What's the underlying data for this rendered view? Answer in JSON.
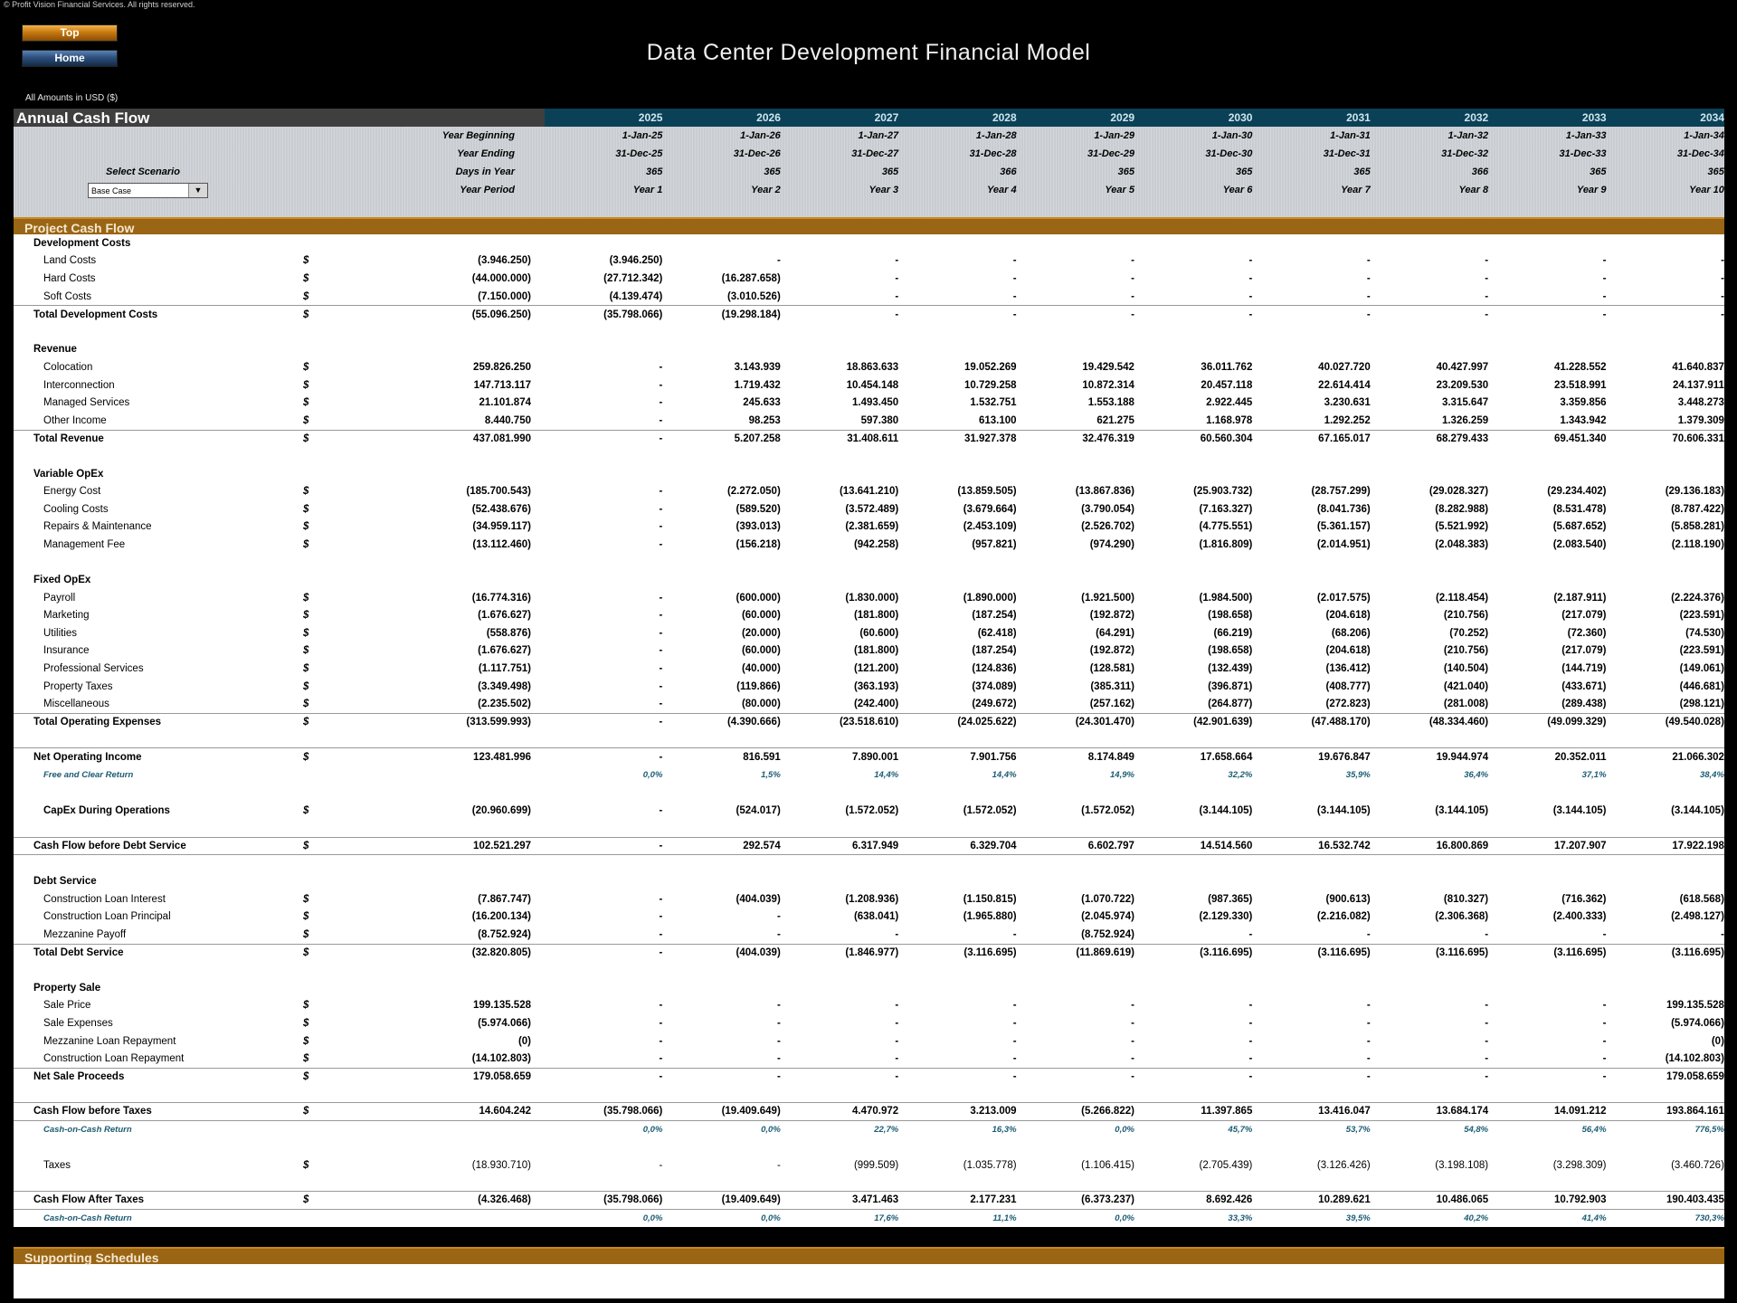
{
  "copyright": "© Profit Vision Financial Services. All rights reserved.",
  "nav": {
    "top_label": "Top",
    "home_label": "Home"
  },
  "title": "Data Center Development Financial Model",
  "amounts_note": "All Amounts in  USD ($)",
  "sheet_title": "Annual Cash Flow",
  "years": [
    "2025",
    "2026",
    "2027",
    "2028",
    "2029",
    "2030",
    "2031",
    "2032",
    "2033",
    "2034"
  ],
  "meta": {
    "labels": {
      "begin": "Year Beginning",
      "end": "Year Ending",
      "days": "Days in Year",
      "period": "Year Period"
    },
    "scenario_label": "Select Scenario",
    "scenario_value": "Base Case",
    "begin": [
      "1-Jan-25",
      "1-Jan-26",
      "1-Jan-27",
      "1-Jan-28",
      "1-Jan-29",
      "1-Jan-30",
      "1-Jan-31",
      "1-Jan-32",
      "1-Jan-33",
      "1-Jan-34"
    ],
    "end": [
      "31-Dec-25",
      "31-Dec-26",
      "31-Dec-27",
      "31-Dec-28",
      "31-Dec-29",
      "31-Dec-30",
      "31-Dec-31",
      "31-Dec-32",
      "31-Dec-33",
      "31-Dec-34"
    ],
    "days": [
      "365",
      "365",
      "365",
      "366",
      "365",
      "365",
      "365",
      "366",
      "365",
      "365"
    ],
    "period": [
      "Year 1",
      "Year 2",
      "Year 3",
      "Year 4",
      "Year 5",
      "Year 6",
      "Year 7",
      "Year 8",
      "Year 9",
      "Year 10"
    ]
  },
  "section_project": "Project Cash Flow",
  "section_support": "Supporting Schedules",
  "currency": "$",
  "rows": [
    {
      "type": "header",
      "label": "Development Costs"
    },
    {
      "type": "sub",
      "label": "Land Costs",
      "total": "(3.946.250)",
      "values": [
        "(3.946.250)",
        "-",
        "-",
        "-",
        "-",
        "-",
        "-",
        "-",
        "-",
        "-"
      ]
    },
    {
      "type": "sub",
      "label": "Hard Costs",
      "total": "(44.000.000)",
      "values": [
        "(27.712.342)",
        "(16.287.658)",
        "-",
        "-",
        "-",
        "-",
        "-",
        "-",
        "-",
        "-"
      ]
    },
    {
      "type": "sub",
      "label": "Soft Costs",
      "total": "(7.150.000)",
      "values": [
        "(4.139.474)",
        "(3.010.526)",
        "-",
        "-",
        "-",
        "-",
        "-",
        "-",
        "-",
        "-"
      ]
    },
    {
      "type": "total",
      "label": "Total Development Costs",
      "total": "(55.096.250)",
      "values": [
        "(35.798.066)",
        "(19.298.184)",
        "-",
        "-",
        "-",
        "-",
        "-",
        "-",
        "-",
        "-"
      ],
      "lineTop": true
    },
    {
      "type": "spacer"
    },
    {
      "type": "header",
      "label": "Revenue"
    },
    {
      "type": "sub",
      "label": "Colocation",
      "total": "259.826.250",
      "values": [
        "-",
        "3.143.939",
        "18.863.633",
        "19.052.269",
        "19.429.542",
        "36.011.762",
        "40.027.720",
        "40.427.997",
        "41.228.552",
        "41.640.837"
      ]
    },
    {
      "type": "sub",
      "label": "Interconnection",
      "total": "147.713.117",
      "values": [
        "-",
        "1.719.432",
        "10.454.148",
        "10.729.258",
        "10.872.314",
        "20.457.118",
        "22.614.414",
        "23.209.530",
        "23.518.991",
        "24.137.911"
      ]
    },
    {
      "type": "sub",
      "label": "Managed Services",
      "total": "21.101.874",
      "values": [
        "-",
        "245.633",
        "1.493.450",
        "1.532.751",
        "1.553.188",
        "2.922.445",
        "3.230.631",
        "3.315.647",
        "3.359.856",
        "3.448.273"
      ]
    },
    {
      "type": "sub",
      "label": "Other Income",
      "total": "8.440.750",
      "values": [
        "-",
        "98.253",
        "597.380",
        "613.100",
        "621.275",
        "1.168.978",
        "1.292.252",
        "1.326.259",
        "1.343.942",
        "1.379.309"
      ]
    },
    {
      "type": "total",
      "label": "Total Revenue",
      "total": "437.081.990",
      "values": [
        "-",
        "5.207.258",
        "31.408.611",
        "31.927.378",
        "32.476.319",
        "60.560.304",
        "67.165.017",
        "68.279.433",
        "69.451.340",
        "70.606.331"
      ],
      "lineTop": true
    },
    {
      "type": "spacer"
    },
    {
      "type": "header",
      "label": "Variable OpEx"
    },
    {
      "type": "sub",
      "label": "Energy Cost",
      "total": "(185.700.543)",
      "values": [
        "-",
        "(2.272.050)",
        "(13.641.210)",
        "(13.859.505)",
        "(13.867.836)",
        "(25.903.732)",
        "(28.757.299)",
        "(29.028.327)",
        "(29.234.402)",
        "(29.136.183)"
      ]
    },
    {
      "type": "sub",
      "label": "Cooling Costs",
      "total": "(52.438.676)",
      "values": [
        "-",
        "(589.520)",
        "(3.572.489)",
        "(3.679.664)",
        "(3.790.054)",
        "(7.163.327)",
        "(8.041.736)",
        "(8.282.988)",
        "(8.531.478)",
        "(8.787.422)"
      ]
    },
    {
      "type": "sub",
      "label": "Repairs & Maintenance",
      "total": "(34.959.117)",
      "values": [
        "-",
        "(393.013)",
        "(2.381.659)",
        "(2.453.109)",
        "(2.526.702)",
        "(4.775.551)",
        "(5.361.157)",
        "(5.521.992)",
        "(5.687.652)",
        "(5.858.281)"
      ]
    },
    {
      "type": "sub",
      "label": "Management Fee",
      "total": "(13.112.460)",
      "values": [
        "-",
        "(156.218)",
        "(942.258)",
        "(957.821)",
        "(974.290)",
        "(1.816.809)",
        "(2.014.951)",
        "(2.048.383)",
        "(2.083.540)",
        "(2.118.190)"
      ]
    },
    {
      "type": "spacer"
    },
    {
      "type": "header",
      "label": "Fixed OpEx"
    },
    {
      "type": "sub",
      "label": "Payroll",
      "total": "(16.774.316)",
      "values": [
        "-",
        "(600.000)",
        "(1.830.000)",
        "(1.890.000)",
        "(1.921.500)",
        "(1.984.500)",
        "(2.017.575)",
        "(2.118.454)",
        "(2.187.911)",
        "(2.224.376)"
      ]
    },
    {
      "type": "sub",
      "label": "Marketing",
      "total": "(1.676.627)",
      "values": [
        "-",
        "(60.000)",
        "(181.800)",
        "(187.254)",
        "(192.872)",
        "(198.658)",
        "(204.618)",
        "(210.756)",
        "(217.079)",
        "(223.591)"
      ]
    },
    {
      "type": "sub",
      "label": "Utilities",
      "total": "(558.876)",
      "values": [
        "-",
        "(20.000)",
        "(60.600)",
        "(62.418)",
        "(64.291)",
        "(66.219)",
        "(68.206)",
        "(70.252)",
        "(72.360)",
        "(74.530)"
      ]
    },
    {
      "type": "sub",
      "label": "Insurance",
      "total": "(1.676.627)",
      "values": [
        "-",
        "(60.000)",
        "(181.800)",
        "(187.254)",
        "(192.872)",
        "(198.658)",
        "(204.618)",
        "(210.756)",
        "(217.079)",
        "(223.591)"
      ]
    },
    {
      "type": "sub",
      "label": "Professional Services",
      "total": "(1.117.751)",
      "values": [
        "-",
        "(40.000)",
        "(121.200)",
        "(124.836)",
        "(128.581)",
        "(132.439)",
        "(136.412)",
        "(140.504)",
        "(144.719)",
        "(149.061)"
      ]
    },
    {
      "type": "sub",
      "label": "Property Taxes",
      "total": "(3.349.498)",
      "values": [
        "-",
        "(119.866)",
        "(363.193)",
        "(374.089)",
        "(385.311)",
        "(396.871)",
        "(408.777)",
        "(421.040)",
        "(433.671)",
        "(446.681)"
      ]
    },
    {
      "type": "sub",
      "label": "Miscellaneous",
      "total": "(2.235.502)",
      "values": [
        "-",
        "(80.000)",
        "(242.400)",
        "(249.672)",
        "(257.162)",
        "(264.877)",
        "(272.823)",
        "(281.008)",
        "(289.438)",
        "(298.121)"
      ]
    },
    {
      "type": "total",
      "label": "Total Operating Expenses",
      "total": "(313.599.993)",
      "values": [
        "-",
        "(4.390.666)",
        "(23.518.610)",
        "(24.025.622)",
        "(24.301.470)",
        "(42.901.639)",
        "(47.488.170)",
        "(48.334.460)",
        "(49.099.329)",
        "(49.540.028)"
      ],
      "lineTop": true
    },
    {
      "type": "spacer",
      "lineBot": true
    },
    {
      "type": "total",
      "label": "Net Operating Income",
      "total": "123.481.996",
      "values": [
        "-",
        "816.591",
        "7.890.001",
        "7.901.756",
        "8.174.849",
        "17.658.664",
        "19.676.847",
        "19.944.974",
        "20.352.011",
        "21.066.302"
      ]
    },
    {
      "type": "pct",
      "label": "Free and Clear Return",
      "values": [
        "0,0%",
        "1,5%",
        "14,4%",
        "14,4%",
        "14,9%",
        "32,2%",
        "35,9%",
        "36,4%",
        "37,1%",
        "38,4%"
      ]
    },
    {
      "type": "spacer"
    },
    {
      "type": "item",
      "label": "CapEx During Operations",
      "total": "(20.960.699)",
      "values": [
        "-",
        "(524.017)",
        "(1.572.052)",
        "(1.572.052)",
        "(1.572.052)",
        "(3.144.105)",
        "(3.144.105)",
        "(3.144.105)",
        "(3.144.105)",
        "(3.144.105)"
      ]
    },
    {
      "type": "spacer"
    },
    {
      "type": "total",
      "label": "Cash Flow before Debt Service",
      "total": "102.521.297",
      "values": [
        "-",
        "292.574",
        "6.317.949",
        "6.329.704",
        "6.602.797",
        "14.514.560",
        "16.532.742",
        "16.800.869",
        "17.207.907",
        "17.922.198"
      ],
      "lineTop": true,
      "lineBot": true
    },
    {
      "type": "spacer"
    },
    {
      "type": "header",
      "label": "Debt Service"
    },
    {
      "type": "sub",
      "label": "Construction Loan Interest",
      "total": "(7.867.747)",
      "values": [
        "-",
        "(404.039)",
        "(1.208.936)",
        "(1.150.815)",
        "(1.070.722)",
        "(987.365)",
        "(900.613)",
        "(810.327)",
        "(716.362)",
        "(618.568)"
      ]
    },
    {
      "type": "sub",
      "label": "Construction Loan Principal",
      "total": "(16.200.134)",
      "values": [
        "-",
        "-",
        "(638.041)",
        "(1.965.880)",
        "(2.045.974)",
        "(2.129.330)",
        "(2.216.082)",
        "(2.306.368)",
        "(2.400.333)",
        "(2.498.127)"
      ]
    },
    {
      "type": "sub",
      "label": "Mezzanine Payoff",
      "total": "(8.752.924)",
      "values": [
        "-",
        "-",
        "-",
        "-",
        "(8.752.924)",
        "-",
        "-",
        "-",
        "-",
        "-"
      ]
    },
    {
      "type": "total",
      "label": "Total Debt Service",
      "total": "(32.820.805)",
      "values": [
        "-",
        "(404.039)",
        "(1.846.977)",
        "(3.116.695)",
        "(11.869.619)",
        "(3.116.695)",
        "(3.116.695)",
        "(3.116.695)",
        "(3.116.695)",
        "(3.116.695)"
      ],
      "lineTop": true
    },
    {
      "type": "spacer"
    },
    {
      "type": "header",
      "label": "Property Sale"
    },
    {
      "type": "sub",
      "label": "Sale Price",
      "total": "199.135.528",
      "values": [
        "-",
        "-",
        "-",
        "-",
        "-",
        "-",
        "-",
        "-",
        "-",
        "199.135.528"
      ]
    },
    {
      "type": "sub",
      "label": "Sale Expenses",
      "total": "(5.974.066)",
      "values": [
        "-",
        "-",
        "-",
        "-",
        "-",
        "-",
        "-",
        "-",
        "-",
        "(5.974.066)"
      ]
    },
    {
      "type": "sub",
      "label": "Mezzanine Loan Repayment",
      "total": "(0)",
      "values": [
        "-",
        "-",
        "-",
        "-",
        "-",
        "-",
        "-",
        "-",
        "-",
        "(0)"
      ]
    },
    {
      "type": "sub",
      "label": "Construction Loan Repayment",
      "total": "(14.102.803)",
      "values": [
        "-",
        "-",
        "-",
        "-",
        "-",
        "-",
        "-",
        "-",
        "-",
        "(14.102.803)"
      ]
    },
    {
      "type": "total",
      "label": "Net Sale Proceeds",
      "total": "179.058.659",
      "values": [
        "-",
        "-",
        "-",
        "-",
        "-",
        "-",
        "-",
        "-",
        "-",
        "179.058.659"
      ],
      "lineTop": true
    },
    {
      "type": "spacer",
      "lineBot": true
    },
    {
      "type": "total",
      "label": "Cash Flow before Taxes",
      "total": "14.604.242",
      "values": [
        "(35.798.066)",
        "(19.409.649)",
        "4.470.972",
        "3.213.009",
        "(5.266.822)",
        "11.397.865",
        "13.416.047",
        "13.684.174",
        "14.091.212",
        "193.864.161"
      ],
      "lineBot": true
    },
    {
      "type": "pct",
      "label": "Cash-on-Cash Return",
      "values": [
        "0,0%",
        "0,0%",
        "22,7%",
        "16,3%",
        "0,0%",
        "45,7%",
        "53,7%",
        "54,8%",
        "56,4%",
        "776,5%"
      ]
    },
    {
      "type": "spacer"
    },
    {
      "type": "taxes",
      "label": "Taxes",
      "total": "(18.930.710)",
      "values": [
        "-",
        "-",
        "(999.509)",
        "(1.035.778)",
        "(1.106.415)",
        "(2.705.439)",
        "(3.126.426)",
        "(3.198.108)",
        "(3.298.309)",
        "(3.460.726)"
      ]
    },
    {
      "type": "spacer",
      "lineBot": true
    },
    {
      "type": "total",
      "label": "Cash Flow After Taxes",
      "total": "(4.326.468)",
      "values": [
        "(35.798.066)",
        "(19.409.649)",
        "3.471.463",
        "2.177.231",
        "(6.373.237)",
        "8.692.426",
        "10.289.621",
        "10.486.065",
        "10.792.903",
        "190.403.435"
      ],
      "lineBot": true
    },
    {
      "type": "pct",
      "label": "Cash-on-Cash Return",
      "values": [
        "0,0%",
        "0,0%",
        "17,6%",
        "11,1%",
        "0,0%",
        "33,3%",
        "39,5%",
        "40,2%",
        "41,4%",
        "730,3%"
      ]
    }
  ]
}
